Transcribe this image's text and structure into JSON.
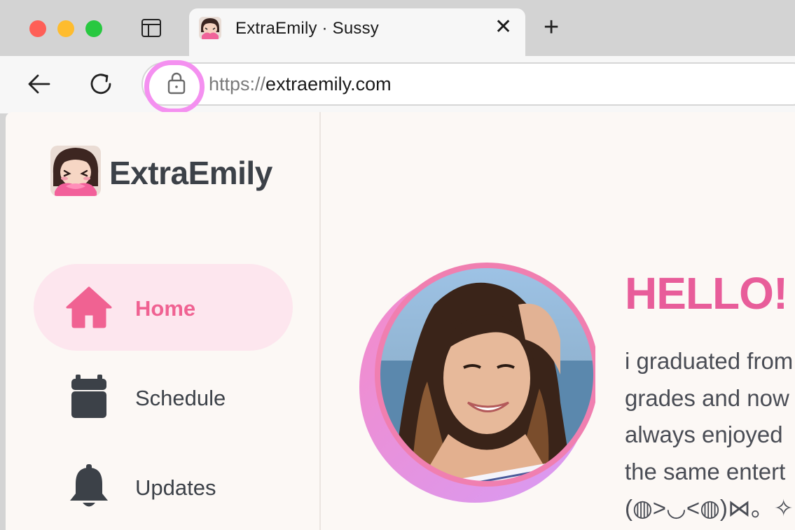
{
  "browser": {
    "tab": {
      "title": "ExtraEmily · Sussy",
      "close_label": "✕"
    },
    "new_tab_label": "+",
    "url": {
      "scheme": "https://",
      "host": "extraemily.com"
    }
  },
  "sidebar": {
    "brand": "ExtraEmily",
    "items": [
      {
        "label": "Home",
        "icon": "home-icon",
        "active": true
      },
      {
        "label": "Schedule",
        "icon": "calendar-icon",
        "active": false
      },
      {
        "label": "Updates",
        "icon": "bell-icon",
        "active": false
      }
    ]
  },
  "main": {
    "greeting": "HELLO! I",
    "bio_lines": [
      "i graduated from",
      "grades and now",
      "always enjoyed",
      "the same entert",
      "(◍>◡<◍)⋈。✧"
    ]
  },
  "colors": {
    "accent": "#e85d9a",
    "nav_active_bg": "#fde6ee",
    "lock_highlight": "#f490f0",
    "page_bg": "#fcf8f5"
  }
}
